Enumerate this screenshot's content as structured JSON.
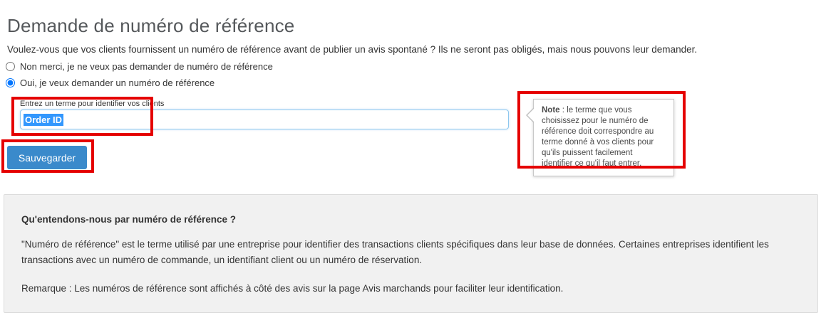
{
  "page": {
    "title": "Demande de numéro de référence",
    "intro": "Voulez-vous que vos clients fournissent un numéro de référence avant de publier un avis spontané ? Ils ne seront pas obligés, mais nous pouvons leur demander."
  },
  "radio_group": {
    "options": [
      {
        "label": "Non merci, je ne veux pas demander de numéro de référence",
        "selected": false
      },
      {
        "label": "Oui, je veux demander un numéro de référence",
        "selected": true
      }
    ]
  },
  "form": {
    "input_label": "Entrez un terme pour identifier vos clients",
    "input_value": "Order ID",
    "save_label": "Sauvegarder"
  },
  "tooltip": {
    "note_label": "Note",
    "body": " : le terme que vous choisissez pour le numéro de référence doit correspondre au terme donné à vos clients pour qu'ils puissent facilement identifier ce qu'il faut entrer."
  },
  "info_panel": {
    "heading": "Qu'entendons-nous par numéro de référence ?",
    "paragraph1": "\"Numéro de référence\" est le terme utilisé par une entreprise pour identifier des transactions clients spécifiques dans leur base de données. Certaines entreprises identifient les transactions avec un numéro de commande, un identifiant client ou un numéro de réservation.",
    "paragraph2": "Remarque : Les numéros de référence sont affichés à côté des avis sur la page Avis marchands pour faciliter leur identification."
  },
  "colors": {
    "annotation_red": "#e50000",
    "button_blue": "#3a8acb",
    "selection_blue": "#3297fd",
    "input_border_blue": "#8dc7ee",
    "panel_bg": "#f1f1f1"
  }
}
